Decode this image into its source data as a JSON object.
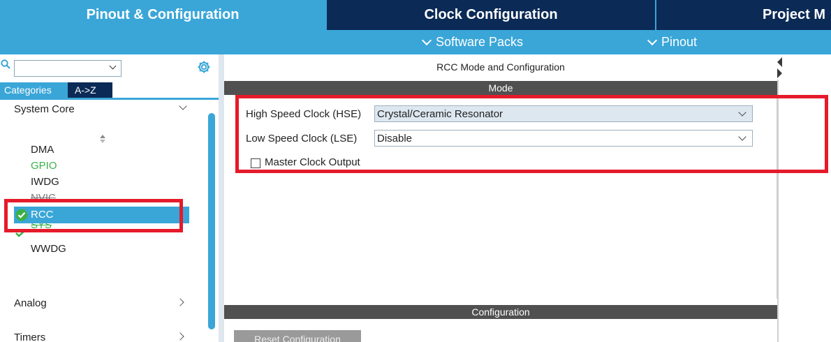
{
  "tabs": [
    {
      "label": "Pinout & Configuration"
    },
    {
      "label": "Clock Configuration"
    },
    {
      "label": "Project M"
    }
  ],
  "subbar": {
    "software_packs": "Software Packs",
    "pinout": "Pinout"
  },
  "left_panel": {
    "search": {
      "value": ""
    },
    "category_tabs": {
      "categories": "Categories",
      "atoz": "A->Z"
    },
    "groups": {
      "system_core": "System Core",
      "analog": "Analog",
      "timers": "Timers"
    },
    "peripherals": [
      {
        "label": "DMA",
        "state": "normal"
      },
      {
        "label": "GPIO",
        "state": "green"
      },
      {
        "label": "IWDG",
        "state": "normal"
      },
      {
        "label": "NVIC",
        "state": "partial"
      },
      {
        "label": "RCC",
        "state": "selected"
      },
      {
        "label": "SYS",
        "state": "partial-checked"
      },
      {
        "label": "WWDG",
        "state": "normal"
      }
    ]
  },
  "main": {
    "title": "RCC Mode and Configuration",
    "mode_header": "Mode",
    "hse": {
      "label": "High Speed Clock (HSE)",
      "value": "Crystal/Ceramic Resonator"
    },
    "lse": {
      "label": "Low Speed Clock (LSE)",
      "value": "Disable"
    },
    "mco": {
      "label": "Master Clock Output",
      "checked": false
    },
    "config_header": "Configuration",
    "reset_button": "Reset Configuration"
  },
  "colors": {
    "nav_dark": "#0b2a56",
    "accent_blue": "#3aa6d8",
    "section_gray": "#505050",
    "ok_green": "#3ab04a",
    "annotation_red": "#e51a2a"
  },
  "icons": [
    "search-icon",
    "gear-icon",
    "chevron-down-icon",
    "chevron-right-icon",
    "check-circle-icon",
    "sort-icon",
    "collapse-left-icon",
    "collapse-right-icon"
  ]
}
